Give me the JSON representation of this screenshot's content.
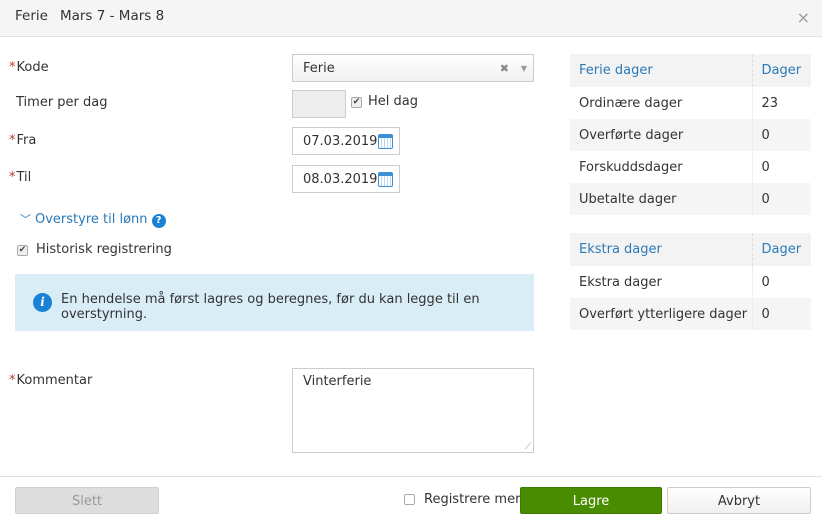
{
  "header": {
    "title": "Ferie",
    "subtitle": "Mars 7 - Mars 8",
    "close": "×"
  },
  "form": {
    "kode_label": "Kode",
    "kode_value": "Ferie",
    "timer_label": "Timer per dag",
    "timer_value": "",
    "hel_dag_label": "Hel dag",
    "hel_dag_checked": true,
    "fra_label": "Fra",
    "fra_value": "07.03.2019",
    "til_label": "Til",
    "til_value": "08.03.2019",
    "overstyre_label": "Overstyre til lønn",
    "historisk_label": "Historisk registrering",
    "historisk_checked": true,
    "info_text": "En hendelse må først lagres og beregnes, før du kan legge til en overstyrning.",
    "kommentar_label": "Kommentar",
    "kommentar_value": "Vinterferie"
  },
  "ferie_table": {
    "headers": [
      "Ferie dager",
      "Dager"
    ],
    "rows": [
      [
        "Ordinære dager",
        "23"
      ],
      [
        "Overførte dager",
        "0"
      ],
      [
        "Forskuddsdager",
        "0"
      ],
      [
        "Ubetalte dager",
        "0"
      ]
    ]
  },
  "ekstra_table": {
    "headers": [
      "Ekstra dager",
      "Dager"
    ],
    "rows": [
      [
        "Ekstra dager",
        "0"
      ],
      [
        "Overført ytterligere dager",
        "0"
      ]
    ]
  },
  "footer": {
    "slett": "Slett",
    "registrere_mer": "Registrere mer",
    "lagre": "Lagre",
    "avbryt": "Avbryt"
  },
  "colors": {
    "accent": "#2a7ab8",
    "save": "#4a8c00",
    "info_bg": "#d9edf7"
  }
}
